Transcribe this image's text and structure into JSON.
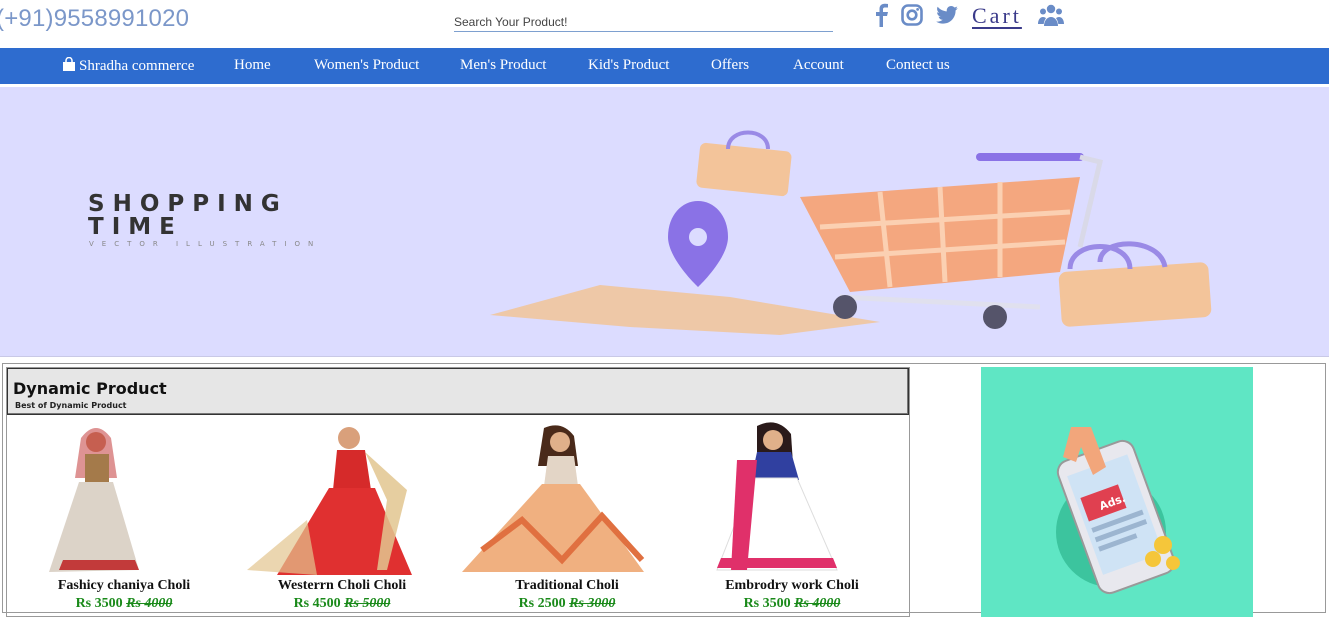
{
  "header": {
    "phone": "(+91)9558991020",
    "search_placeholder": "Search Your Product!",
    "cart_label": "Cart",
    "icons": [
      "facebook-icon",
      "instagram-icon",
      "twitter-icon",
      "users-icon"
    ],
    "icon_color": "#6a8cc7"
  },
  "nav": {
    "brand": "Shradha commerce",
    "items": [
      "Home",
      "Women's Product",
      "Men's Product",
      "Kid's Product",
      "Offers",
      "Account",
      "Contect us"
    ],
    "bg_color": "#2e6ccf"
  },
  "hero": {
    "title_line1": "SHOPPING",
    "title_line2": "TIME",
    "subtitle": "VECTOR ILLUSTRATION",
    "bg_color": "#dcdcff"
  },
  "section": {
    "title": "Dynamic Product",
    "subtitle": "Best of Dynamic Product",
    "products": [
      {
        "name": "Fashicy chaniya Choli",
        "price": "Rs 3500",
        "old_price": "Rs 4000"
      },
      {
        "name": "Westerrn Choli Choli",
        "price": "Rs 4500",
        "old_price": "Rs 5000"
      },
      {
        "name": "Traditional Choli",
        "price": "Rs 2500",
        "old_price": "Rs 3000"
      },
      {
        "name": "Embrodry work Choli",
        "price": "Rs 3500",
        "old_price": "Rs 4000"
      }
    ]
  },
  "ad": {
    "label": "Ads.",
    "bg_color": "#5fe6c4"
  }
}
